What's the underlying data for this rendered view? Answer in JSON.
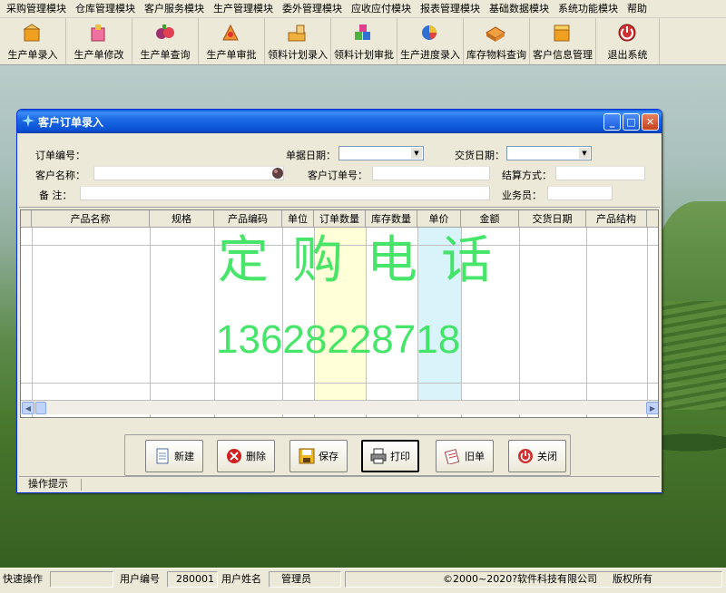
{
  "menu": [
    "采购管理模块",
    "仓库管理模块",
    "客户服务模块",
    "生产管理模块",
    "委外管理模块",
    "应收应付模块",
    "报表管理模块",
    "基础数据模块",
    "系统功能模块",
    "帮助"
  ],
  "toolbar": [
    {
      "label": "生产单录入",
      "icon": "box-add-icon",
      "color": "#f0a020"
    },
    {
      "label": "生产单修改",
      "icon": "box-edit-icon",
      "color": "#e05060"
    },
    {
      "label": "生产单查询",
      "icon": "search-box-icon",
      "color": "#a03070"
    },
    {
      "label": "生产单审批",
      "icon": "approve-icon",
      "color": "#e07020"
    },
    {
      "label": "领料计划录入",
      "icon": "material-add-icon",
      "color": "#e0a030"
    },
    {
      "label": "领料计划审批",
      "icon": "material-approve-icon",
      "color": "#50b040"
    },
    {
      "label": "生产进度录入",
      "icon": "progress-chart-icon",
      "color": "#3070d0"
    },
    {
      "label": "库存物料查询",
      "icon": "inventory-icon",
      "color": "#e08030"
    },
    {
      "label": "客户信息管理",
      "icon": "customer-icon",
      "color": "#f0a020"
    },
    {
      "label": "退出系统",
      "icon": "power-icon",
      "color": "#d03030"
    }
  ],
  "dialog": {
    "title": "客户订单录入",
    "fields": {
      "order_no": "订单编号：",
      "doc_date": "单据日期：",
      "delivery_date": "交货日期：",
      "customer_name": "客户名称：",
      "customer_order_no": "客户订单号：",
      "settle_method": "结算方式：",
      "remark": "备  注：",
      "salesman": "业务员："
    },
    "columns": [
      "产品名称",
      "规格",
      "产品编码",
      "单位",
      "订单数量",
      "库存数量",
      "单价",
      "金额",
      "交货日期",
      "产品结构"
    ],
    "watermark_title": "定购电话",
    "watermark_phone": "13628228718",
    "buttons": [
      "新建",
      "删除",
      "保存",
      "打印",
      "旧单",
      "关闭"
    ],
    "hint": "操作提示"
  },
  "status": {
    "quick": "快速操作",
    "user_no_label": "用户编号",
    "user_no": "280001",
    "user_name_label": "用户姓名",
    "user_name": "管理员",
    "copyright": "©2000~2020?",
    "company": "软件科技有限公司",
    "rights": "版权所有"
  }
}
